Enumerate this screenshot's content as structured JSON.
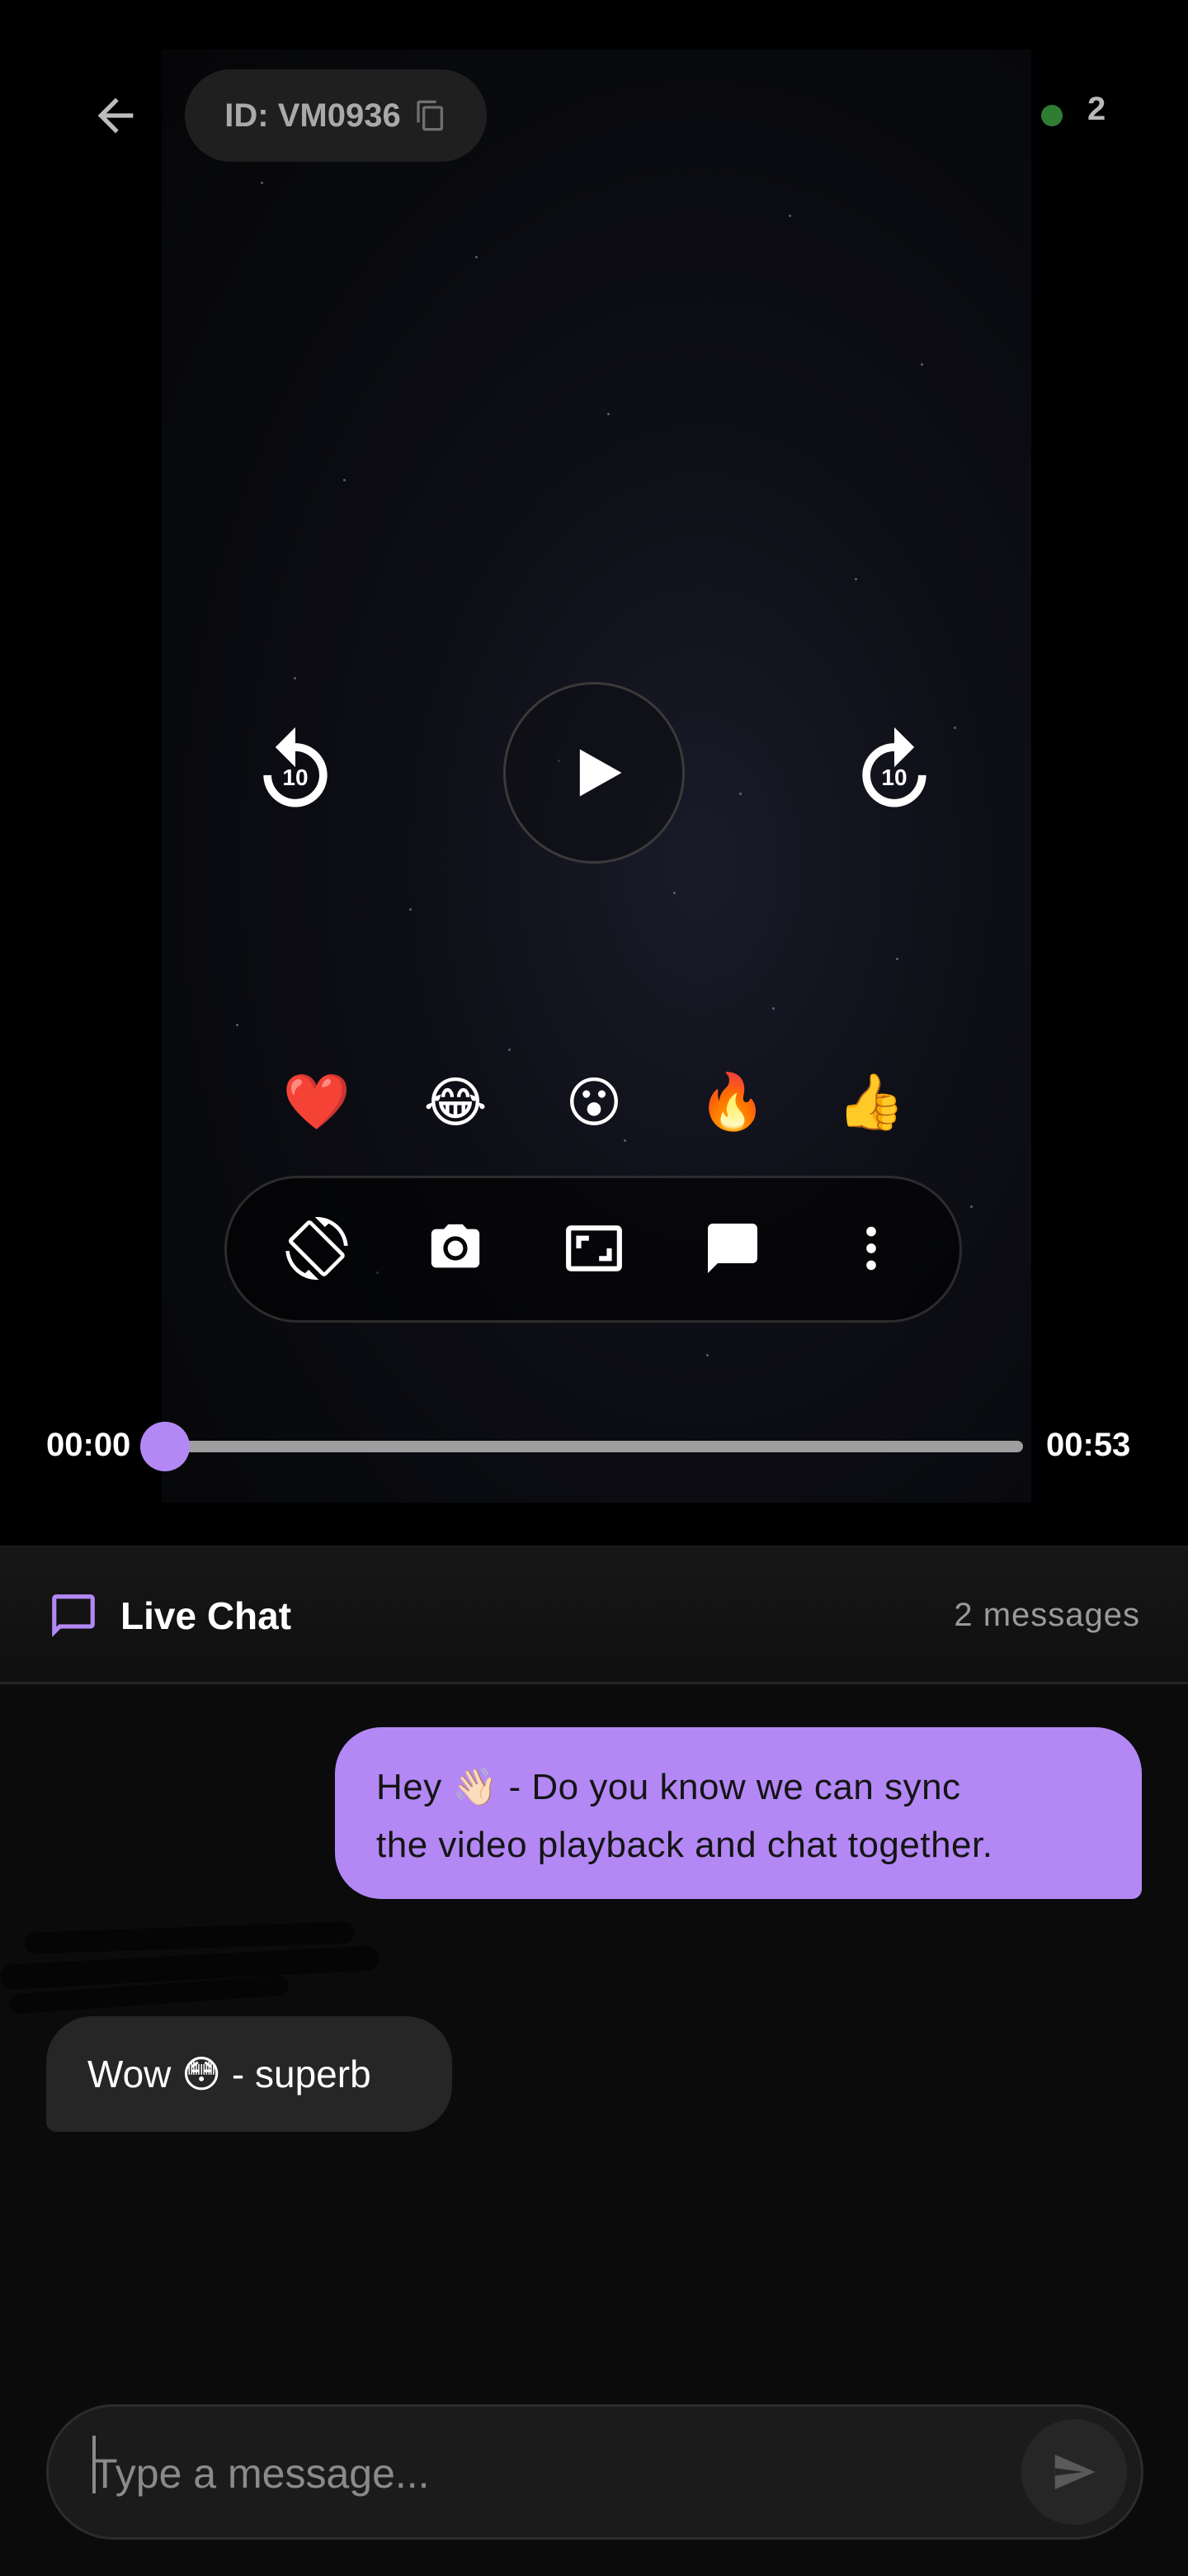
{
  "header": {
    "back_icon": "arrow-left-icon",
    "id_label": "ID: VM0936",
    "copy_icon": "copy-icon",
    "viewer_count": "2",
    "online_color": "#2e7d32"
  },
  "player": {
    "rewind_label": "10",
    "forward_label": "10",
    "play_icon": "play-icon",
    "reactions": [
      "❤️",
      "😂",
      "😮",
      "🔥",
      "👍"
    ],
    "toolbar_icons": [
      "screen-rotation-icon",
      "camera-icon",
      "aspect-ratio-icon",
      "chat-bubble-icon",
      "more-vertical-icon"
    ],
    "current_time": "00:00",
    "total_time": "00:53",
    "progress_fraction": 0.0,
    "accent_color": "#b388f5"
  },
  "chat": {
    "title": "Live Chat",
    "message_count": "2 messages",
    "messages": [
      {
        "direction": "outgoing",
        "line1": "Hey 👋🏻 - Do you know we can sync",
        "line2": "the video playback and chat together."
      },
      {
        "direction": "incoming",
        "text": "Wow 😳 - superb"
      }
    ],
    "input_placeholder": "Type a message...",
    "send_icon": "send-icon"
  }
}
